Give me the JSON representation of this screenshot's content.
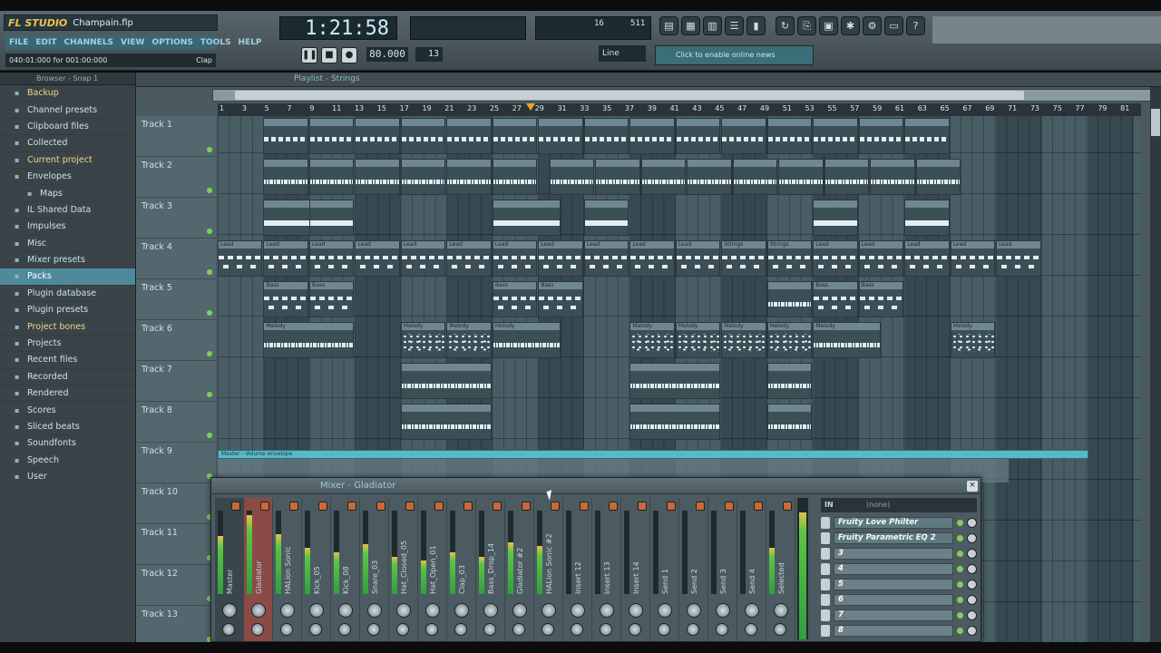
{
  "app": {
    "logo": "FL STUDIO",
    "project_file": "Champain.flp",
    "menu": [
      "FILE",
      "EDIT",
      "CHANNELS",
      "VIEW",
      "OPTIONS",
      "TOOLS",
      "HELP"
    ],
    "hint_left": "040:01:000 for 001:00:000",
    "hint_right": "Clap"
  },
  "transport": {
    "time": "1:21:58",
    "tempo": "80.000",
    "pattern": "13",
    "cpu_value": "16",
    "poly_value": "511",
    "snap_mode": "Line",
    "hint_window": "Click to enable online news"
  },
  "browser": {
    "title": "Browser - Snap 1",
    "items": [
      {
        "label": "Backup",
        "hl": true
      },
      {
        "label": "Channel presets",
        "hl": false
      },
      {
        "label": "Clipboard files",
        "hl": false
      },
      {
        "label": "Collected",
        "hl": false
      },
      {
        "label": "Current project",
        "hl": true
      },
      {
        "label": "Envelopes",
        "hl": false
      },
      {
        "label": "Maps",
        "hl": false,
        "sub": true
      },
      {
        "label": "IL Shared Data",
        "hl": false
      },
      {
        "label": "Impulses",
        "hl": false
      },
      {
        "label": "Misc",
        "hl": false
      },
      {
        "label": "Mixer presets",
        "hl": false
      },
      {
        "label": "Packs",
        "hl": false,
        "selected": true
      },
      {
        "label": "Plugin database",
        "hl": false
      },
      {
        "label": "Plugin presets",
        "hl": false
      },
      {
        "label": "Project bones",
        "hl": true
      },
      {
        "label": "Projects",
        "hl": false
      },
      {
        "label": "Recent files",
        "hl": false
      },
      {
        "label": "Recorded",
        "hl": false
      },
      {
        "label": "Rendered",
        "hl": false
      },
      {
        "label": "Scores",
        "hl": false
      },
      {
        "label": "Sliced beats",
        "hl": false
      },
      {
        "label": "Soundfonts",
        "hl": false
      },
      {
        "label": "Speech",
        "hl": false
      },
      {
        "label": "User",
        "hl": false
      }
    ]
  },
  "playlist": {
    "title": "Playlist - Strings",
    "ruler": [
      "1",
      "3",
      "5",
      "7",
      "9",
      "11",
      "13",
      "15",
      "17",
      "19",
      "21",
      "23",
      "25",
      "27",
      "29",
      "31",
      "33",
      "35",
      "37",
      "39",
      "41",
      "43",
      "45",
      "47",
      "49",
      "51",
      "53",
      "55",
      "57",
      "59",
      "61",
      "63",
      "65",
      "67",
      "69",
      "71",
      "73",
      "75",
      "77",
      "79",
      "81"
    ],
    "tracks": [
      "Track 1",
      "Track 2",
      "Track 3",
      "Track 4",
      "Track 5",
      "Track 6",
      "Track 7",
      "Track 8",
      "Track 9",
      "Track 10",
      "Track 11",
      "Track 12",
      "Track 13"
    ],
    "clip_names": {
      "lead": "Lead",
      "strings": "Strings",
      "bass": "Bass",
      "melody": "Melody",
      "automation": "Master - Volume envelope"
    }
  },
  "mixer": {
    "title": "Mixer - Gladiator",
    "fx_in_label": "IN",
    "fx_in_value": "(none)",
    "strips": [
      {
        "name": "Master",
        "level": 0.7
      },
      {
        "name": "Gladiator",
        "level": 0.95
      },
      {
        "name": "HALion Sonic",
        "level": 0.72
      },
      {
        "name": "Kick_05",
        "level": 0.55
      },
      {
        "name": "Kick_08",
        "level": 0.5
      },
      {
        "name": "Snare_03",
        "level": 0.6
      },
      {
        "name": "Hat_Closed_05",
        "level": 0.45
      },
      {
        "name": "Hat_Open_01",
        "level": 0.4
      },
      {
        "name": "Clap_03",
        "level": 0.5
      },
      {
        "name": "Bass_Drop_14",
        "level": 0.45
      },
      {
        "name": "Gladiator #2",
        "level": 0.62
      },
      {
        "name": "HALion Sonic #2",
        "level": 0.58
      },
      {
        "name": "Insert 12",
        "level": 0.0
      },
      {
        "name": "Insert 13",
        "level": 0.0
      },
      {
        "name": "Insert 14",
        "level": 0.0
      },
      {
        "name": "Send 1",
        "level": 0.0
      },
      {
        "name": "Send 2",
        "level": 0.0
      },
      {
        "name": "Send 3",
        "level": 0.0
      },
      {
        "name": "Send 4",
        "level": 0.0
      },
      {
        "name": "Selected",
        "level": 0.55
      }
    ],
    "fx_slots": [
      "Fruity Love Philter",
      "Fruity Parametric EQ 2",
      "3",
      "4",
      "5",
      "6",
      "7",
      "8"
    ]
  }
}
